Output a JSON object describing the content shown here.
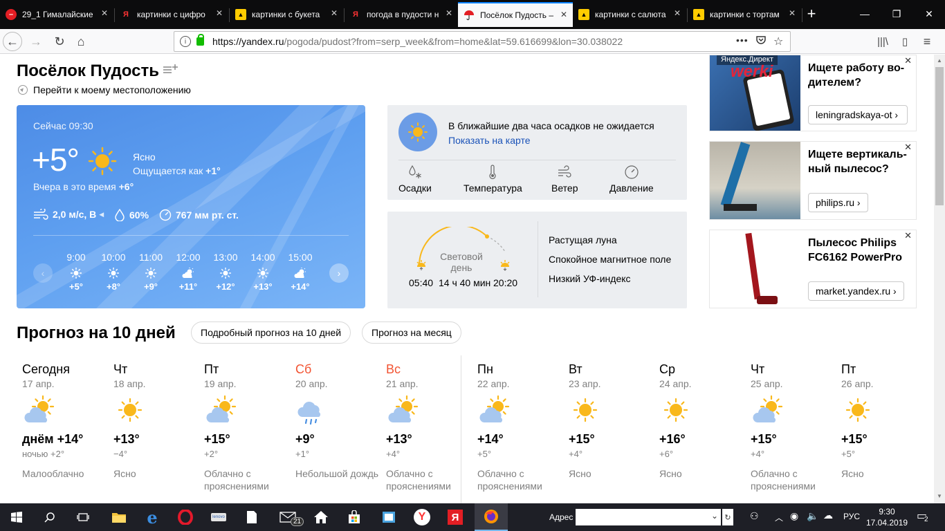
{
  "browser": {
    "tabs": [
      {
        "title": "29_1 Гималайские",
        "icon": "red-circle-icon"
      },
      {
        "title": "картинки с цифро",
        "icon": "yandex-icon"
      },
      {
        "title": "картинки с букета",
        "icon": "yandex-images-icon"
      },
      {
        "title": "погода в пудости н",
        "icon": "yandex-icon"
      },
      {
        "title": "Посёлок Пудость –",
        "icon": "umbrella-icon",
        "active": true
      },
      {
        "title": "картинки с салюта",
        "icon": "yandex-images-icon"
      },
      {
        "title": "картинки с тортам",
        "icon": "yandex-images-icon"
      }
    ],
    "url_host": "https://yandex.ru",
    "url_path": "/pogoda/pudost?from=serp_week&from=home&lat=59.616699&lon=30.038022"
  },
  "header": {
    "city": "Посёлок Пудость",
    "locate_link": "Перейти к моему местоположению"
  },
  "now": {
    "time": "Сейчас 09:30",
    "temp": "+5°",
    "condition": "Ясно",
    "feels_label": "Ощущается как",
    "feels_value": "+1°",
    "yesterday_label": "Вчера в это время",
    "yesterday_value": "+6°",
    "wind": "2,0 м/с, В",
    "humidity": "60%",
    "pressure": "767 мм рт. ст.",
    "hours": [
      {
        "time": "9:00",
        "temp": "+5°",
        "icon": "sun-icon"
      },
      {
        "time": "10:00",
        "temp": "+8°",
        "icon": "sun-icon"
      },
      {
        "time": "11:00",
        "temp": "+9°",
        "icon": "sun-icon"
      },
      {
        "time": "12:00",
        "temp": "+11°",
        "icon": "partly-cloudy-icon"
      },
      {
        "time": "13:00",
        "temp": "+12°",
        "icon": "sun-icon"
      },
      {
        "time": "14:00",
        "temp": "+13°",
        "icon": "sun-icon"
      },
      {
        "time": "15:00",
        "temp": "+14°",
        "icon": "partly-cloudy-icon"
      }
    ]
  },
  "precip": {
    "text": "В ближайшие два часа осадков не ожидается",
    "link": "Показать на карте",
    "tabs": [
      "Осадки",
      "Температура",
      "Ветер",
      "Давление"
    ]
  },
  "sun": {
    "day_label_1": "Световой",
    "day_label_2": "день",
    "sunrise": "05:40",
    "duration": "14 ч 40 мин",
    "sunset": "20:20",
    "facts": [
      "Растущая луна",
      "Спокойное магнитное поле",
      "Низкий УФ-индекс"
    ]
  },
  "ads": [
    {
      "title": "Ищете работу во-дителем?",
      "button": "leningradskaya-ot",
      "label": "Яндекс.Директ",
      "logo": "werki"
    },
    {
      "title": "Ищете вертикаль-ный пылесос?",
      "button": "philips.ru"
    },
    {
      "title": "Пылесос Philips FC6162 PowerPro",
      "button": "market.yandex.ru"
    }
  ],
  "forecast": {
    "title": "Прогноз на 10 дней",
    "btn_detail": "Подробный прогноз на 10 дней",
    "btn_month": "Прогноз на месяц",
    "days": [
      {
        "name": "Сегодня",
        "date": "17 апр.",
        "temp": "днём +14°",
        "night": "ночью +2°",
        "cond": "Малооблачно",
        "icon": "partly-cloudy-icon",
        "weekend": false
      },
      {
        "name": "Чт",
        "date": "18 апр.",
        "temp": "+13°",
        "night": "−4°",
        "cond": "Ясно",
        "icon": "sun-icon",
        "weekend": false
      },
      {
        "name": "Пт",
        "date": "19 апр.",
        "temp": "+15°",
        "night": "+2°",
        "cond": "Облачно с прояснениями",
        "icon": "partly-cloudy-icon",
        "weekend": false
      },
      {
        "name": "Сб",
        "date": "20 апр.",
        "temp": "+9°",
        "night": "+1°",
        "cond": "Небольшой дождь",
        "icon": "rain-icon",
        "weekend": true
      },
      {
        "name": "Вс",
        "date": "21 апр.",
        "temp": "+13°",
        "night": "+4°",
        "cond": "Облачно с прояснениями",
        "icon": "partly-cloudy-icon",
        "weekend": true
      },
      {
        "name": "Пн",
        "date": "22 апр.",
        "temp": "+14°",
        "night": "+5°",
        "cond": "Облачно с прояснениями",
        "icon": "partly-cloudy-icon",
        "weekend": false
      },
      {
        "name": "Вт",
        "date": "23 апр.",
        "temp": "+15°",
        "night": "+4°",
        "cond": "Ясно",
        "icon": "sun-icon",
        "weekend": false
      },
      {
        "name": "Ср",
        "date": "24 апр.",
        "temp": "+16°",
        "night": "+6°",
        "cond": "Ясно",
        "icon": "sun-icon",
        "weekend": false
      },
      {
        "name": "Чт",
        "date": "25 апр.",
        "temp": "+15°",
        "night": "+4°",
        "cond": "Облачно с прояснениями",
        "icon": "partly-cloudy-icon",
        "weekend": false
      },
      {
        "name": "Пт",
        "date": "26 апр.",
        "temp": "+15°",
        "night": "+5°",
        "cond": "Ясно",
        "icon": "sun-icon",
        "weekend": false
      }
    ]
  },
  "taskbar": {
    "address_label": "Адрес",
    "lang": "РУС",
    "time": "9:30",
    "date": "17.04.2019",
    "mail_badge": "21",
    "notif_badge": "2"
  },
  "colors": {
    "accent": "#0a84ff",
    "weekend": "#f25433",
    "link": "#1a52b8",
    "sun": "#f9b81b",
    "cloud": "#a7c7ef"
  }
}
